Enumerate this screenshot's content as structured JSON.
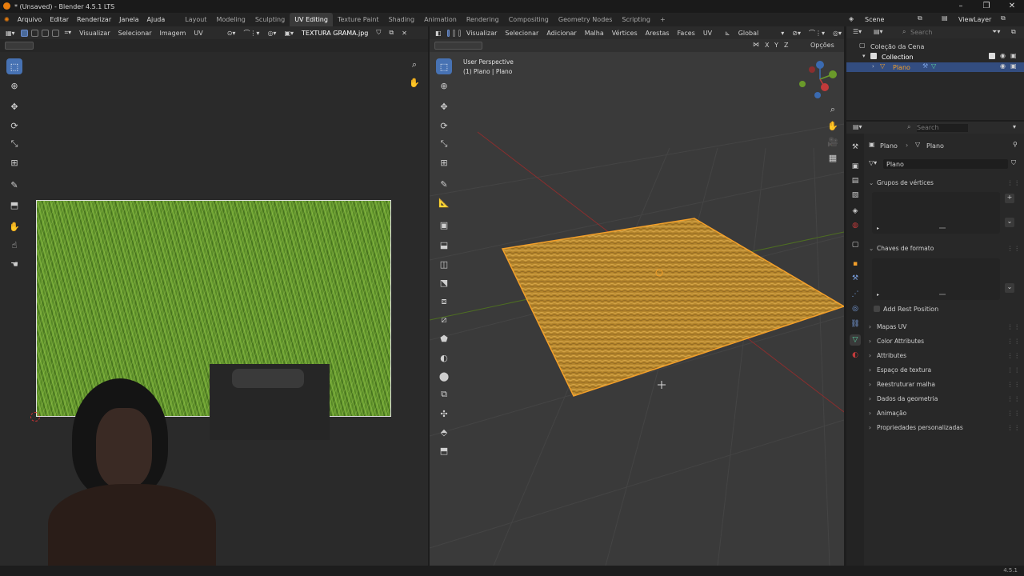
{
  "window": {
    "title": "* (Unsaved) - Blender 4.5.1 LTS"
  },
  "menus": [
    "Arquivo",
    "Editar",
    "Renderizar",
    "Janela",
    "Ajuda"
  ],
  "workspaces": [
    "Layout",
    "Modeling",
    "Sculpting",
    "UV Editing",
    "Texture Paint",
    "Shading",
    "Animation",
    "Rendering",
    "Compositing",
    "Geometry Nodes",
    "Scripting"
  ],
  "active_workspace": "UV Editing",
  "scene": {
    "name": "Scene",
    "view_layer": "ViewLayer"
  },
  "uv_editor": {
    "menus": [
      "Visualizar",
      "Selecionar",
      "Imagem",
      "UV"
    ],
    "image_name": "TEXTURA GRAMA.jpg"
  },
  "viewport": {
    "menus": [
      "Visualizar",
      "Selecionar",
      "Adicionar",
      "Malha",
      "Vértices",
      "Arestas",
      "Faces",
      "UV"
    ],
    "orientation": "Global",
    "axes": [
      "X",
      "Y",
      "Z"
    ],
    "options_label": "Opções",
    "overlay_line1": "User Perspective",
    "overlay_line2": "(1) Plano | Plano"
  },
  "outliner": {
    "search_placeholder": "Search",
    "scene_collection": "Coleção da Cena",
    "collection": "Collection",
    "object": "Plano"
  },
  "properties": {
    "search_placeholder": "Search",
    "breadcrumb_object": "Plano",
    "breadcrumb_mesh": "Plano",
    "mesh_name": "Plano",
    "panel_vertex_groups": "Grupos de vértices",
    "panel_shape_keys": "Chaves de formato",
    "add_rest_position": "Add Rest Position",
    "panels": [
      "Mapas UV",
      "Color Attributes",
      "Attributes",
      "Espaço de textura",
      "Reestruturar malha",
      "Dados da geometria",
      "Animação",
      "Propriedades personalizadas"
    ]
  },
  "status": {
    "version": "4.5.1"
  },
  "colors": {
    "accent": "#4772b3",
    "selection": "#f29f2a",
    "x_axis": "#c23a3a",
    "y_axis": "#6a9a2a"
  }
}
